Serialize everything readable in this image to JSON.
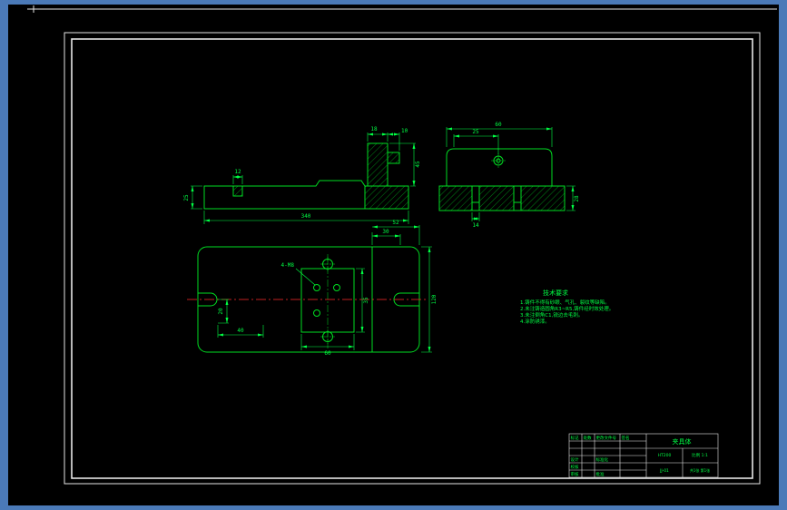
{
  "colors": {
    "bg": "#4b7ab8",
    "canvas": "#000000",
    "frame": "#e6e6e6",
    "line": "#00dd22",
    "dim": "#00ff44",
    "red": "#ff2a2a"
  },
  "dims": {
    "front": {
      "slot": "12",
      "height": "25",
      "col_width": "18",
      "tab": "10",
      "col_height": "45",
      "overall": "340"
    },
    "side": {
      "offset": "25",
      "width": "60",
      "base_height": "28",
      "slot": "14"
    },
    "plan": {
      "step": "30",
      "right": "52",
      "height": "120",
      "notch": "20",
      "left_span": "40",
      "pocket_h": "35",
      "pocket_w": "60",
      "holes": "4-M8"
    }
  },
  "tech_notes": {
    "title": "技术要求",
    "lines": [
      "1.铸件不得有砂眼、气孔、裂纹等缺陷。",
      "2.未注铸造圆角R3~R5,铸件经时效处理。",
      "3.未注倒角C1,锐边去毛刺。",
      "4.涂防锈漆。"
    ]
  },
  "title_block": {
    "mark_label": "标记",
    "count_label": "处数",
    "file_label": "更改文件号",
    "sign_label": "签名",
    "design_label": "设计",
    "standard_label": "标准化",
    "check_label": "校核",
    "audit_label": "审核",
    "approve_label": "批准",
    "part_name": "夹具体",
    "material": "HT200",
    "scale_text": "比例 1:1",
    "drawing_no": "JJ-01",
    "sheet_info": "共1张 第1张"
  }
}
